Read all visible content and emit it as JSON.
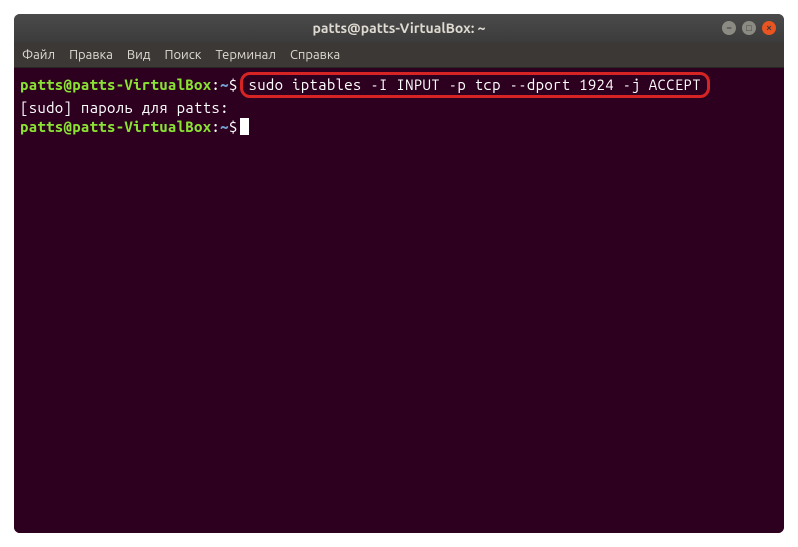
{
  "titlebar": {
    "title": "patts@patts-VirtualBox: ~"
  },
  "window_controls": {
    "minimize": "−",
    "maximize": "□",
    "close": "×"
  },
  "menubar": {
    "file": "Файл",
    "edit": "Правка",
    "view": "Вид",
    "search": "Поиск",
    "terminal": "Терминал",
    "help": "Справка"
  },
  "terminal": {
    "lines": [
      {
        "user": "patts@patts-VirtualBox",
        "sep": ":",
        "path": "~",
        "dollar": "$",
        "command": "sudo iptables -I INPUT -p tcp --dport 1924 -j ACCEPT",
        "highlighted": true
      },
      {
        "plain": "[sudo] пароль для patts: "
      },
      {
        "user": "patts@patts-VirtualBox",
        "sep": ":",
        "path": "~",
        "dollar": "$",
        "command": "",
        "cursor": true
      }
    ]
  }
}
